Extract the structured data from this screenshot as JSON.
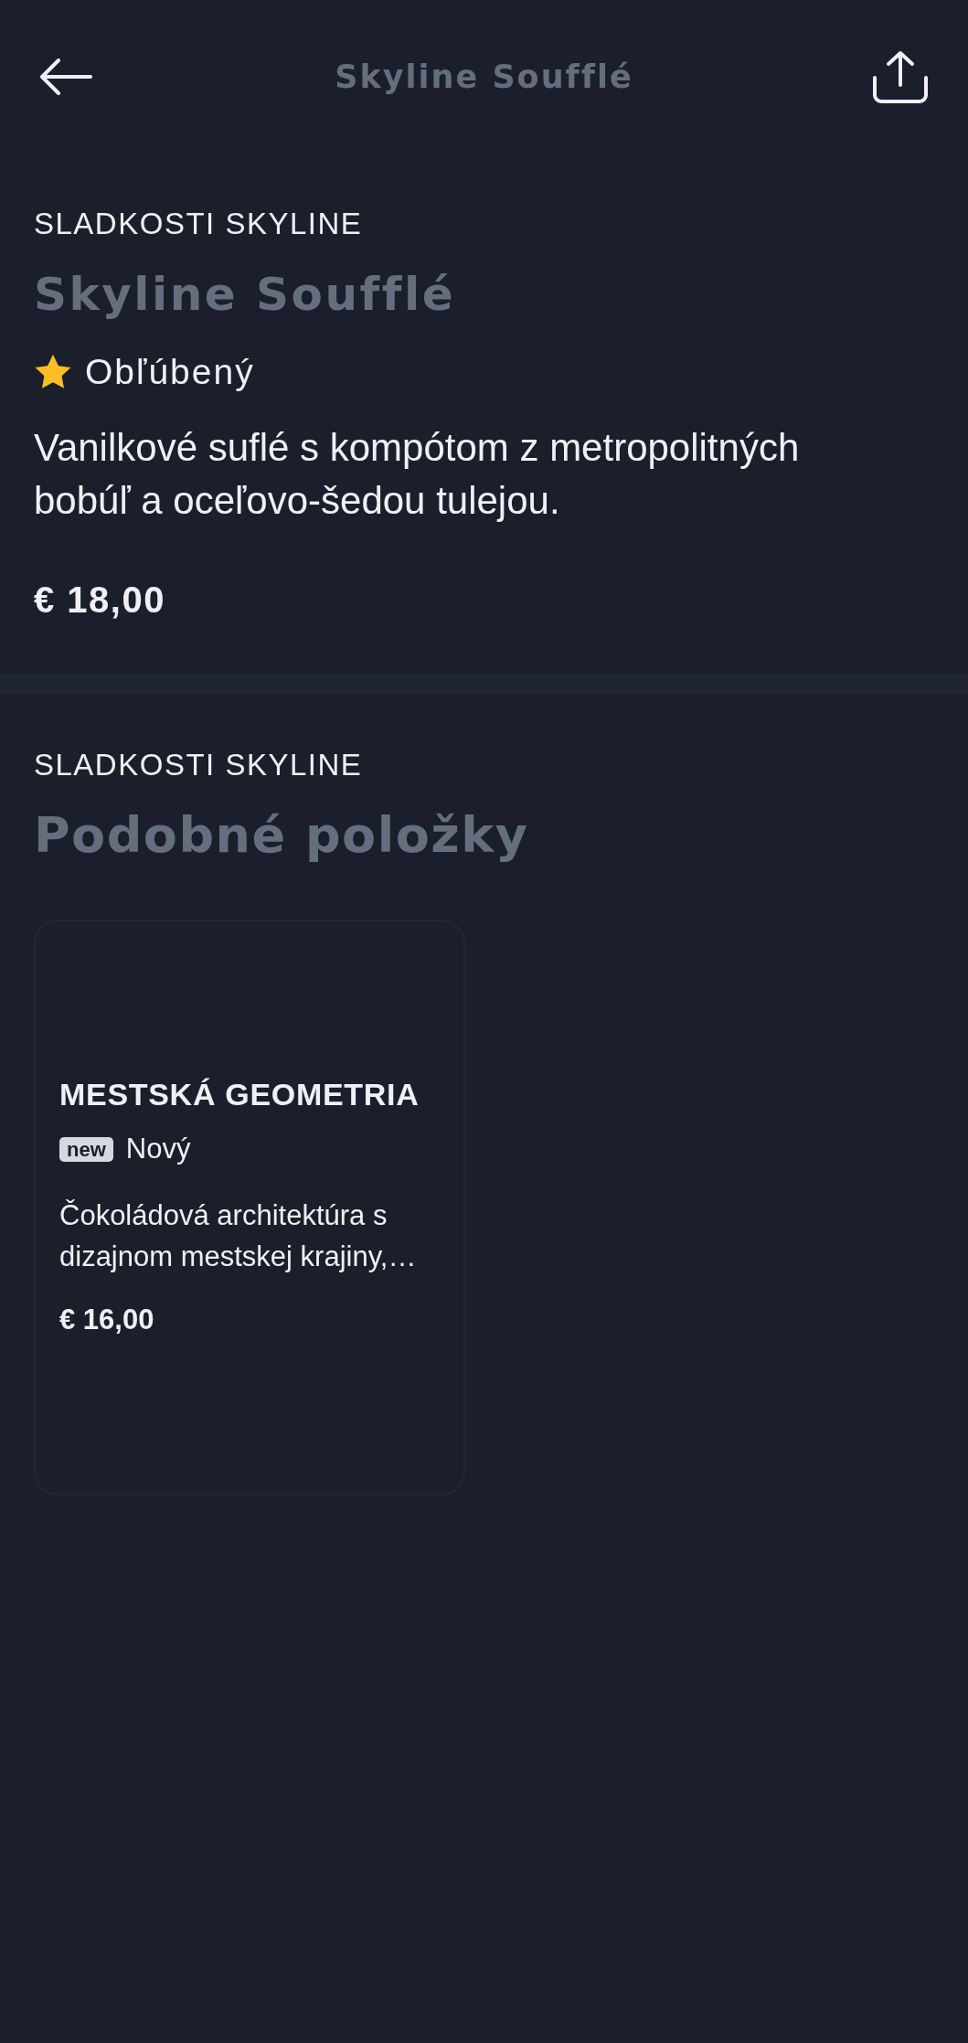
{
  "top_bar": {
    "title": "Skyline Soufflé"
  },
  "item": {
    "category": "SLADKOSTI SKYLINE",
    "name": "Skyline Soufflé",
    "badge": {
      "kind": "favorite",
      "label": "Obľúbený"
    },
    "description": "Vanilkové suflé s kompótom z metropolitných bobúľ a oceľovo-šedou tulejou.",
    "price": "€ 18,00"
  },
  "similar": {
    "category": "SLADKOSTI SKYLINE",
    "heading": "Podobné položky",
    "items": [
      {
        "name": "MESTSKÁ GEOMETRIA",
        "badge": {
          "kind": "new",
          "tag": "new",
          "label": "Nový"
        },
        "description": "Čokoládová architektúra s dizajnom mestskej krajiny,…",
        "price": "€ 16,00"
      }
    ]
  }
}
